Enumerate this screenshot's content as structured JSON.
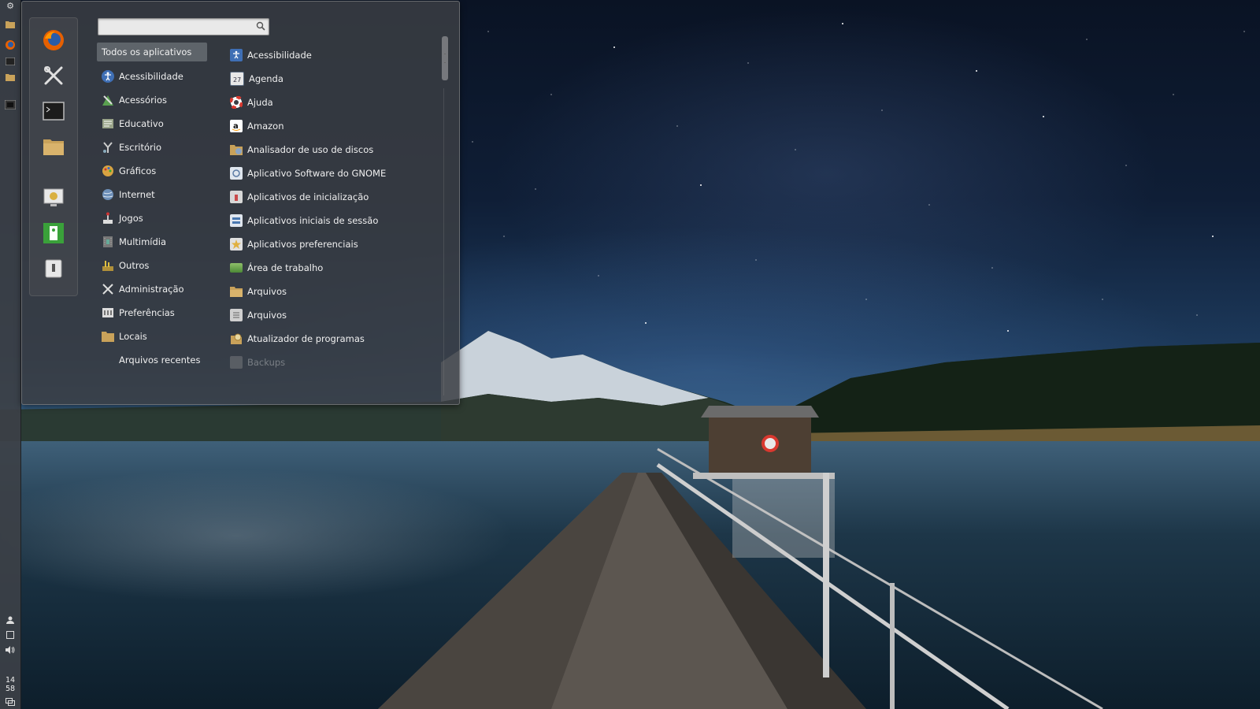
{
  "search": {
    "value": "",
    "placeholder": ""
  },
  "favorites": [
    {
      "name": "firefox-icon",
      "color": "#e66000"
    },
    {
      "name": "system-settings-icon",
      "color": "#dddddd"
    },
    {
      "name": "terminal-icon",
      "color": "#1c1c1c"
    },
    {
      "name": "folder-icon",
      "color": "#c9a25a"
    },
    {
      "name": "screensaver-icon",
      "color": "#e8e8e8"
    },
    {
      "name": "logout-icon",
      "color": "#3aa13a"
    },
    {
      "name": "shutdown-icon",
      "color": "#e8e8e8"
    }
  ],
  "categories": [
    {
      "label": "Todos os aplicativos",
      "icon": "",
      "selected": true
    },
    {
      "label": "Acessibilidade",
      "icon": "accessibility-icon"
    },
    {
      "label": "Acessórios",
      "icon": "accessories-icon"
    },
    {
      "label": "Educativo",
      "icon": "education-icon"
    },
    {
      "label": "Escritório",
      "icon": "office-icon"
    },
    {
      "label": "Gráficos",
      "icon": "graphics-icon"
    },
    {
      "label": "Internet",
      "icon": "internet-icon"
    },
    {
      "label": "Jogos",
      "icon": "games-icon"
    },
    {
      "label": "Multimídia",
      "icon": "multimedia-icon"
    },
    {
      "label": "Outros",
      "icon": "other-icon"
    },
    {
      "label": "Administração",
      "icon": "administration-icon"
    },
    {
      "label": "Preferências",
      "icon": "preferences-icon"
    },
    {
      "label": "Locais",
      "icon": "places-folder-icon"
    },
    {
      "label": "Arquivos recentes",
      "icon": ""
    }
  ],
  "apps": [
    {
      "label": "Acessibilidade",
      "icon": "accessibility-icon",
      "color": "#3f6fb5"
    },
    {
      "label": "Agenda",
      "icon": "calendar-icon",
      "color": "#5a6b80"
    },
    {
      "label": "Ajuda",
      "icon": "help-lifebuoy-icon",
      "color": "#d9382f"
    },
    {
      "label": "Amazon",
      "icon": "amazon-icon",
      "color": "#ffffff"
    },
    {
      "label": "Analisador de uso de discos",
      "icon": "disk-usage-icon",
      "color": "#c9a25a"
    },
    {
      "label": "Aplicativo Software do GNOME",
      "icon": "gnome-software-icon",
      "color": "#8aa4c4"
    },
    {
      "label": "Aplicativos de inicialização",
      "icon": "startup-apps-icon",
      "color": "#c94a4a"
    },
    {
      "label": "Aplicativos iniciais de sessão",
      "icon": "session-apps-icon",
      "color": "#4a78b0"
    },
    {
      "label": "Aplicativos preferenciais",
      "icon": "preferred-apps-icon",
      "color": "#e0b040"
    },
    {
      "label": "Área de trabalho",
      "icon": "desktop-icon",
      "color": "#5c9a45"
    },
    {
      "label": "Arquivos",
      "icon": "folder-icon",
      "color": "#c9a25a"
    },
    {
      "label": "Arquivos",
      "icon": "archive-icon",
      "color": "#9a9a9a"
    },
    {
      "label": "Atualizador de programas",
      "icon": "updater-icon",
      "color": "#c9a25a"
    },
    {
      "label": "Backups",
      "icon": "backups-icon",
      "color": "#9a9a9a",
      "faded": true
    }
  ],
  "panel": {
    "clock_hour": "14",
    "clock_minute": "58",
    "top_icons": [
      "settings-gear-icon",
      "folder-icon",
      "firefox-icon",
      "terminal-icon",
      "folder-icon",
      "window-list-icon"
    ],
    "bottom_icons": [
      "user-icon",
      "display-icon",
      "volume-icon",
      "workspace-icon"
    ]
  }
}
